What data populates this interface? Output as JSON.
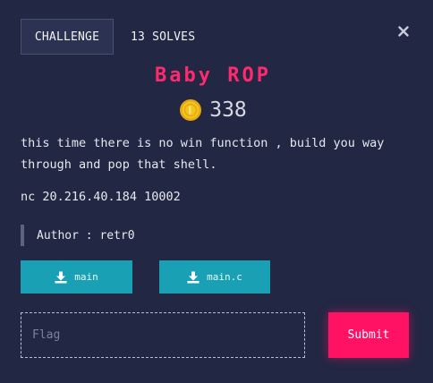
{
  "tabs": {
    "challenge_label": "CHALLENGE",
    "solves_label": "13 SOLVES"
  },
  "challenge": {
    "name": "Baby ROP",
    "points": "338",
    "description": "this time there is no win function , build you way through and pop that shell.",
    "connection": "nc 20.216.40.184 10002",
    "author": "Author : retr0"
  },
  "files": [
    {
      "label": "main",
      "icon": "download-icon"
    },
    {
      "label": "main.c",
      "icon": "download-icon"
    }
  ],
  "flag_form": {
    "placeholder": "Flag",
    "submit_label": "Submit"
  },
  "colors": {
    "background": "#222744",
    "accent": "#ff2a6d",
    "submit": "#ff1264",
    "file_button": "#1aa0b5",
    "coin": "#f5c518"
  }
}
